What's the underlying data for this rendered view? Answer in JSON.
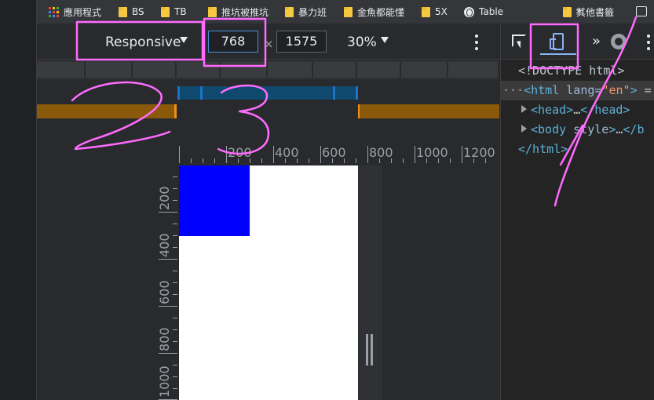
{
  "bookmarks_bar": {
    "items": [
      {
        "label": "應用程式",
        "icon": "apps-grid-icon"
      },
      {
        "label": "BS",
        "icon": "folder-icon"
      },
      {
        "label": "TB",
        "icon": "folder-icon"
      },
      {
        "label": "推坑被推坑",
        "icon": "folder-icon"
      },
      {
        "label": "暴力班",
        "icon": "folder-icon"
      },
      {
        "label": "金魚都能懂",
        "icon": "folder-icon"
      },
      {
        "label": "5X",
        "icon": "folder-icon"
      },
      {
        "label": "Table",
        "icon": "globe-icon"
      },
      {
        "label": "其他書籤",
        "icon": "folder-icon"
      }
    ],
    "overflow_label": "»"
  },
  "device_toolbar": {
    "device_mode": "Responsive",
    "width_value": "768",
    "height_value": "1575",
    "times": "×",
    "zoom": "30%"
  },
  "rulers": {
    "top_labels": [
      "200",
      "400",
      "600",
      "800",
      "1000",
      "1200"
    ],
    "left_labels": [
      "200",
      "400",
      "600",
      "800",
      "1000"
    ]
  },
  "devtools": {
    "more_tabs": "»",
    "dom_tree": [
      {
        "text": "<!DOCTYPE html>"
      },
      {
        "prefix": "···",
        "open": "<html",
        "attr": " lang=",
        "val": "\"en\"",
        "close": ">",
        "suffix": " ="
      },
      {
        "open": "<head>",
        "ellipsis": "…",
        "close": "</head>"
      },
      {
        "open": "<body",
        "attr": " style",
        "close": ">",
        "ellipsis": "…",
        "end": "</b"
      },
      {
        "open": "</html>"
      }
    ]
  },
  "annotations": {
    "label_1": "1",
    "label_2": "2",
    "label_3": "3",
    "color": "#ff6bff"
  },
  "colors": {
    "content_box": "#0000ff",
    "viewport_bg": "#ffffff",
    "mq_blue": "#0f4a6e",
    "mq_orange": "#8a5a0a",
    "accent": "#8ab4f8"
  }
}
